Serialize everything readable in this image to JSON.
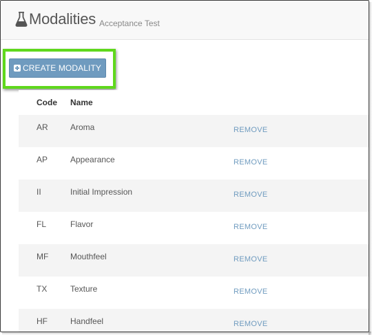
{
  "header": {
    "title": "Modalities",
    "subtitle": "Acceptance Test",
    "icon": "flask-icon"
  },
  "toolbar": {
    "create_label": "CREATE MODALITY",
    "create_icon": "plus-square-icon",
    "highlight_color": "#5fd81c",
    "button_color": "#6f9bbf"
  },
  "table": {
    "columns": [
      "Code",
      "Name"
    ],
    "rows": [
      {
        "code": "AR",
        "name": "Aroma",
        "action": "REMOVE"
      },
      {
        "code": "AP",
        "name": "Appearance",
        "action": "REMOVE"
      },
      {
        "code": "II",
        "name": "Initial Impression",
        "action": "REMOVE"
      },
      {
        "code": "FL",
        "name": "Flavor",
        "action": "REMOVE"
      },
      {
        "code": "MF",
        "name": "Mouthfeel",
        "action": "REMOVE"
      },
      {
        "code": "TX",
        "name": "Texture",
        "action": "REMOVE"
      },
      {
        "code": "HF",
        "name": "Handfeel",
        "action": "REMOVE"
      }
    ]
  }
}
